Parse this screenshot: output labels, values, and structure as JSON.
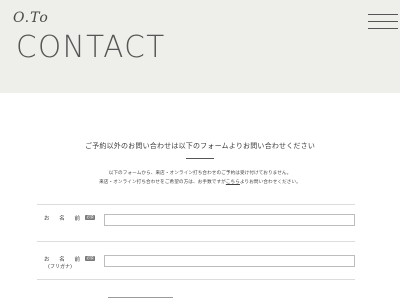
{
  "header": {
    "brand": "O.To",
    "title": "CONTACT",
    "menu_icon": "hamburger-menu-icon"
  },
  "intro": {
    "heading": "ご予約以外のお問い合わせは以下のフォームよりお問い合わせください",
    "line1": "以下のフォームから、来店・オンライン打ち合わせのご予約は受け付けておりません。",
    "line2_before": "来店・オンライン打ち合わせをご希望の方は、お手数ですが",
    "line2_link": "こちら",
    "line2_after": "よりお問い合わせください。"
  },
  "form": {
    "fields": [
      {
        "label": "お 名 前",
        "sublabel": "",
        "badge": "必須",
        "value": ""
      },
      {
        "label": "お 名 前",
        "sublabel": "(フリガナ)",
        "badge": "必須",
        "value": ""
      }
    ]
  },
  "colors": {
    "hero_background": "#eeeeea",
    "badge_background": "#777777",
    "text": "#3a3a3a"
  }
}
